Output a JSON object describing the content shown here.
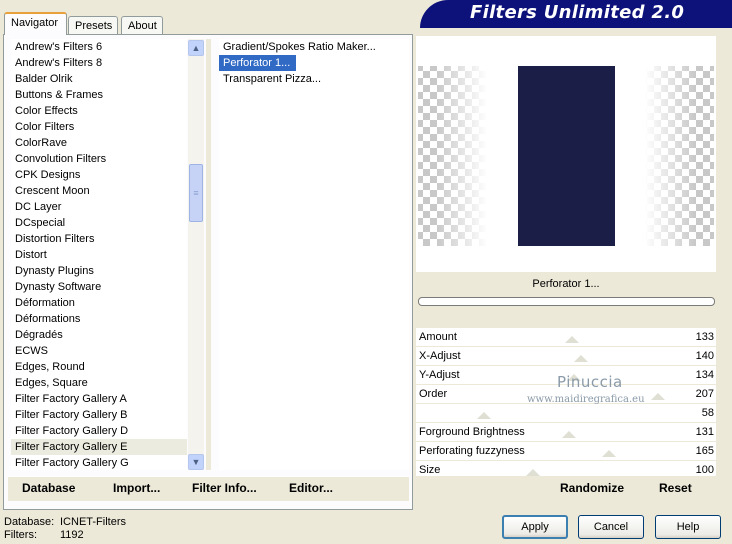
{
  "tabs": [
    {
      "label": "Navigator",
      "active": true
    },
    {
      "label": "Presets",
      "active": false
    },
    {
      "label": "About",
      "active": false
    }
  ],
  "banner": {
    "title": "Filters Unlimited 2.0"
  },
  "categories": {
    "items": [
      "Andrew's Filters 6",
      "Andrew's Filters 8",
      "Balder Olrik",
      "Buttons & Frames",
      "Color Effects",
      "Color Filters",
      "ColorRave",
      "Convolution Filters",
      "CPK Designs",
      "Crescent Moon",
      "DC Layer",
      "DCspecial",
      "Distortion Filters",
      "Distort",
      "Dynasty Plugins",
      "Dynasty Software",
      "Déformation",
      "Déformations",
      "Dégradés",
      "ECWS",
      "Edges, Round",
      "Edges, Square",
      "Filter Factory Gallery A",
      "Filter Factory Gallery B",
      "Filter Factory Gallery D",
      "Filter Factory Gallery E",
      "Filter Factory Gallery G"
    ],
    "selected": "Filter Factory Gallery E"
  },
  "filters": {
    "items": [
      "Gradient/Spokes Ratio Maker...",
      "Perforator 1...",
      "Transparent Pizza..."
    ],
    "selected": "Perforator 1..."
  },
  "left_buttons": {
    "database": "Database",
    "import": "Import...",
    "filter_info": "Filter Info...",
    "editor": "Editor..."
  },
  "preview": {
    "filter_name": "Perforator 1...",
    "progress": 0,
    "center_color": "#1b1f47"
  },
  "params": [
    {
      "label": "Amount",
      "value": "133"
    },
    {
      "label": "X-Adjust",
      "value": "140"
    },
    {
      "label": "Y-Adjust",
      "value": "134"
    },
    {
      "label": "Order",
      "value": "207"
    },
    {
      "label": "",
      "value": "58"
    },
    {
      "label": "Forground Brightness",
      "value": "131"
    },
    {
      "label": "Perforating fuzzyness",
      "value": "165"
    },
    {
      "label": "Size",
      "value": "100"
    }
  ],
  "right_buttons": {
    "randomize": "Randomize",
    "reset": "Reset"
  },
  "watermark": {
    "line1": "Pinuccia",
    "line2": "www.maidiregrafica.eu"
  },
  "footer": {
    "database_label": "Database:",
    "database_value": "ICNET-Filters",
    "filters_label": "Filters:",
    "filters_value": "1192"
  },
  "dialog_buttons": {
    "apply": "Apply",
    "cancel": "Cancel",
    "help": "Help"
  }
}
